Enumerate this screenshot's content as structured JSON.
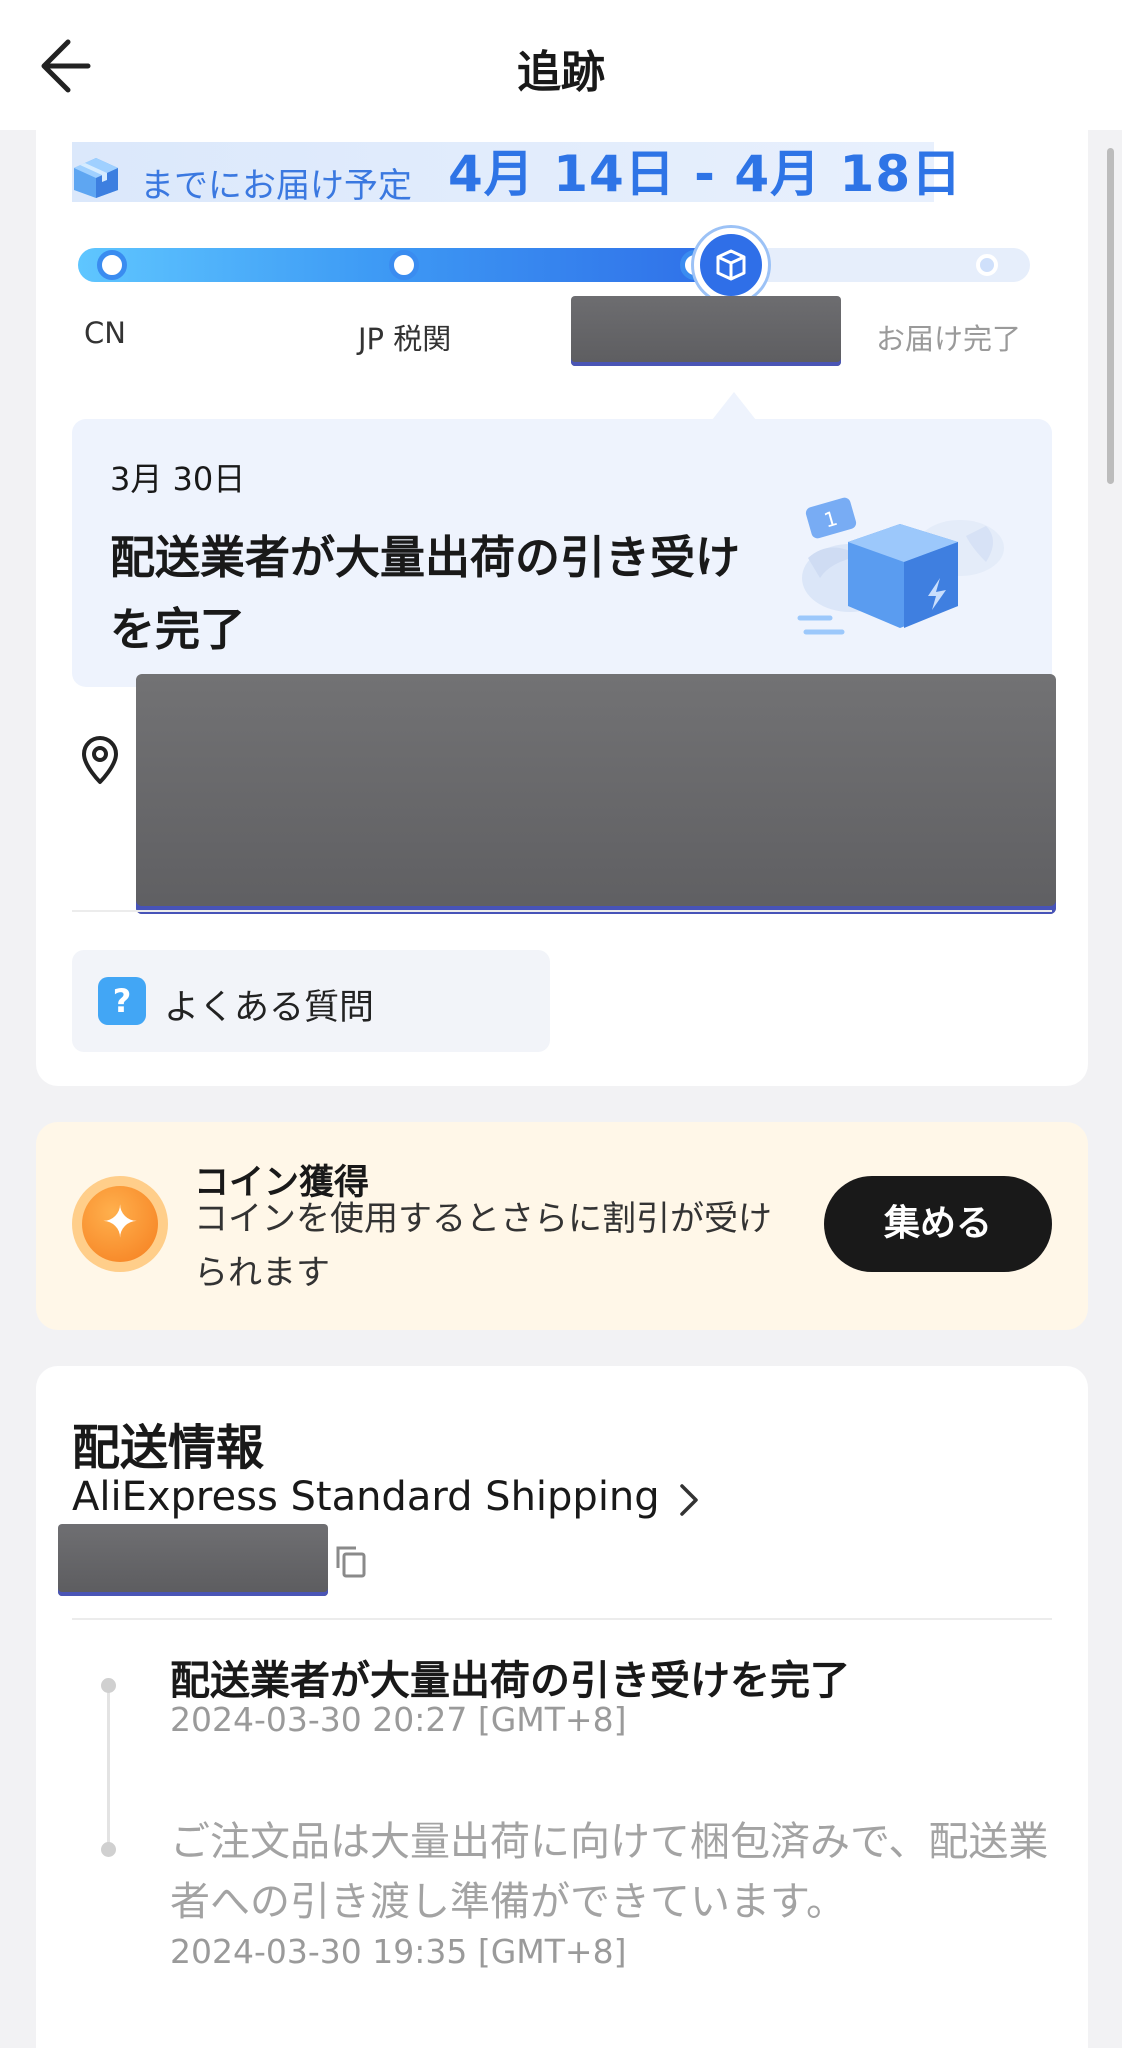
{
  "header": {
    "title": "追跡",
    "back_icon": "arrow-left-icon"
  },
  "estimate": {
    "label": "までにお届け予定",
    "date_range": "4月 14日 - 4月 18日",
    "icon": "package-box-icon",
    "accent_color": "#2e74e6"
  },
  "progress": {
    "stages": [
      "CN",
      "JP 税関",
      "お届け完了"
    ],
    "completed_fraction": 0.68,
    "fill_color": "#3a8cf0"
  },
  "latest_event": {
    "date": "3月 30日",
    "title": "配送業者が大量出荷の引き受けを完了",
    "illustration": "winged-package-illustration"
  },
  "faq": {
    "label": "よくある質問",
    "icon": "question-icon"
  },
  "coins": {
    "title": "コイン獲得",
    "description": "コインを使用するとさらに割引が受けられます",
    "button_label": "集める",
    "icon": "coin-star-icon"
  },
  "shipping": {
    "section_title": "配送情報",
    "method": "AliExpress Standard Shipping",
    "events": [
      {
        "title": "配送業者が大量出荷の引き受けを完了",
        "time": "2024-03-30 20:27 [GMT+8]"
      },
      {
        "title": "ご注文品は大量出荷に向けて梱包済みで、配送業者への引き渡し準備ができています。",
        "time": "2024-03-30 19:35 [GMT+8]"
      }
    ]
  }
}
